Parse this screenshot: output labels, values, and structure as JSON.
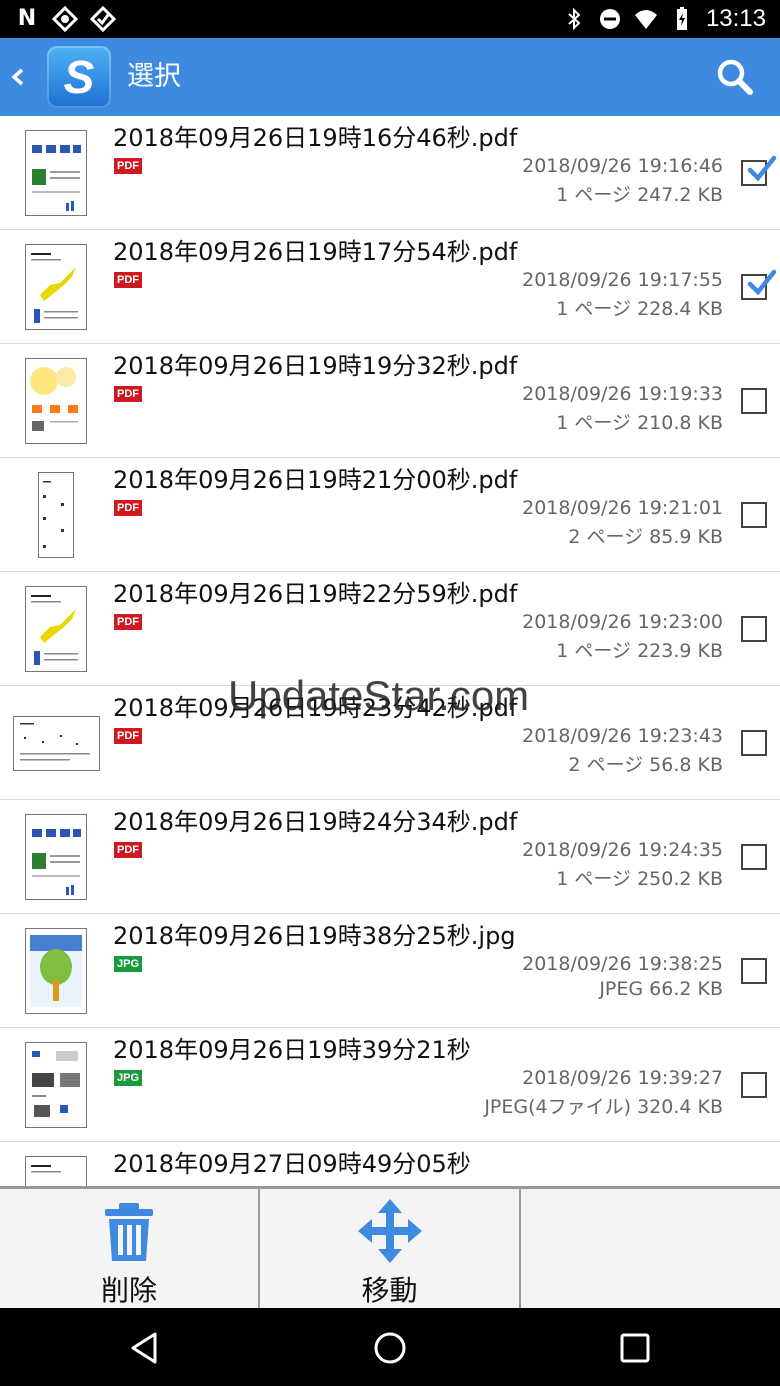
{
  "status_bar": {
    "time": "13:13",
    "left_icons": [
      "N",
      "❀",
      "❀"
    ]
  },
  "app_bar": {
    "title": "選択",
    "logo_letter": "S"
  },
  "files": [
    {
      "name": "2018年09月26日19時16分46秒.pdf",
      "type": "PDF",
      "date": "2018/09/26 19:16:46",
      "info": "1 ページ 247.2 KB",
      "checked": true
    },
    {
      "name": "2018年09月26日19時17分54秒.pdf",
      "type": "PDF",
      "date": "2018/09/26 19:17:55",
      "info": "1 ページ 228.4 KB",
      "checked": true
    },
    {
      "name": "2018年09月26日19時19分32秒.pdf",
      "type": "PDF",
      "date": "2018/09/26 19:19:33",
      "info": "1 ページ 210.8 KB",
      "checked": false
    },
    {
      "name": "2018年09月26日19時21分00秒.pdf",
      "type": "PDF",
      "date": "2018/09/26 19:21:01",
      "info": "2 ページ 85.9 KB",
      "checked": false
    },
    {
      "name": "2018年09月26日19時22分59秒.pdf",
      "type": "PDF",
      "date": "2018/09/26 19:23:00",
      "info": "1 ページ 223.9 KB",
      "checked": false
    },
    {
      "name": "2018年09月26日19時23分42秒.pdf",
      "type": "PDF",
      "date": "2018/09/26 19:23:43",
      "info": "2 ページ 56.8 KB",
      "checked": false
    },
    {
      "name": "2018年09月26日19時24分34秒.pdf",
      "type": "PDF",
      "date": "2018/09/26 19:24:35",
      "info": "1 ページ 250.2 KB",
      "checked": false
    },
    {
      "name": "2018年09月26日19時38分25秒.jpg",
      "type": "JPG",
      "date": "2018/09/26 19:38:25",
      "info": "JPEG 66.2 KB",
      "checked": false
    },
    {
      "name": "2018年09月26日19時39分21秒",
      "type": "JPG",
      "date": "2018/09/26 19:39:27",
      "info": "JPEG(4ファイル) 320.4 KB",
      "checked": false
    },
    {
      "name": "2018年09月27日09時49分05秒",
      "type": "",
      "date": "",
      "info": "",
      "checked": false
    }
  ],
  "actions": {
    "delete_label": "削除",
    "move_label": "移動"
  },
  "watermark": "UpdateStar.com",
  "colors": {
    "app_bar": "#3d8ae0",
    "accent": "#3d8ae0",
    "pdf_badge": "#d0181f",
    "jpg_badge": "#1a9a3c"
  }
}
